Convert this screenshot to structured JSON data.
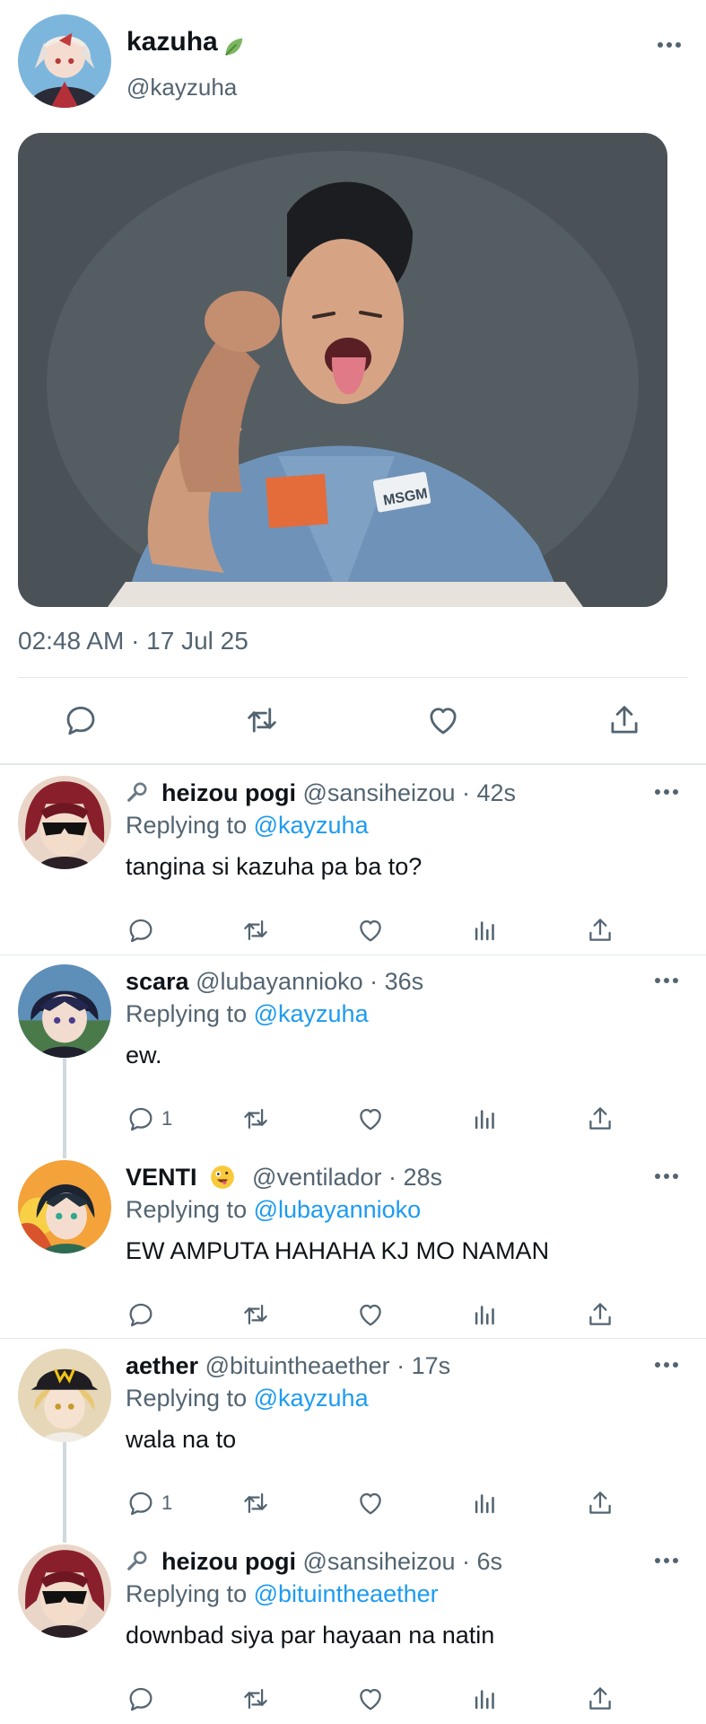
{
  "main_tweet": {
    "author_name": "kazuha",
    "author_handle": "@kayzuha",
    "name_emoji_icon": "leaf-icon",
    "timestamp": "02:48 AM · 17 Jul 25",
    "photo_text": "MSGM",
    "actions": [
      "reply-icon",
      "retweet-icon",
      "like-icon",
      "share-icon"
    ]
  },
  "replies": [
    {
      "name": "heizou pogi",
      "prefix_icon": "magnifier-icon",
      "handle": "@sansiheizou",
      "time": "· 42s",
      "replying_label": "Replying to",
      "replying_to": "@kayzuha",
      "text": "tangina si kazuha pa ba to?",
      "reply_count": ""
    },
    {
      "name": "scara",
      "handle": "@lubayannioko",
      "time": "· 36s",
      "replying_label": "Replying to",
      "replying_to": "@kayzuha",
      "text": "ew.",
      "reply_count": "1"
    },
    {
      "name": "VENTI",
      "suffix_icon": "zany-face-emoji-icon",
      "handle": "@ventilador",
      "time": "· 28s",
      "replying_label": "Replying to",
      "replying_to": "@lubayannioko",
      "text": "EW AMPUTA HAHAHA KJ MO NAMAN",
      "reply_count": ""
    },
    {
      "name": "aether",
      "handle": "@bituintheaether",
      "time": "· 17s",
      "replying_label": "Replying to",
      "replying_to": "@kayzuha",
      "text": "wala na to",
      "reply_count": "1"
    },
    {
      "name": "heizou pogi",
      "prefix_icon": "magnifier-icon",
      "handle": "@sansiheizou",
      "time": "· 6s",
      "replying_label": "Replying to",
      "replying_to": "@bituintheaether",
      "text": "downbad siya par hayaan na natin",
      "reply_count": ""
    }
  ],
  "colors": {
    "link": "#1d9bf0",
    "secondary_text": "#536471",
    "primary_text": "#0f1419",
    "divider": "#e1e8ed",
    "thread_line": "#cfd9de"
  }
}
